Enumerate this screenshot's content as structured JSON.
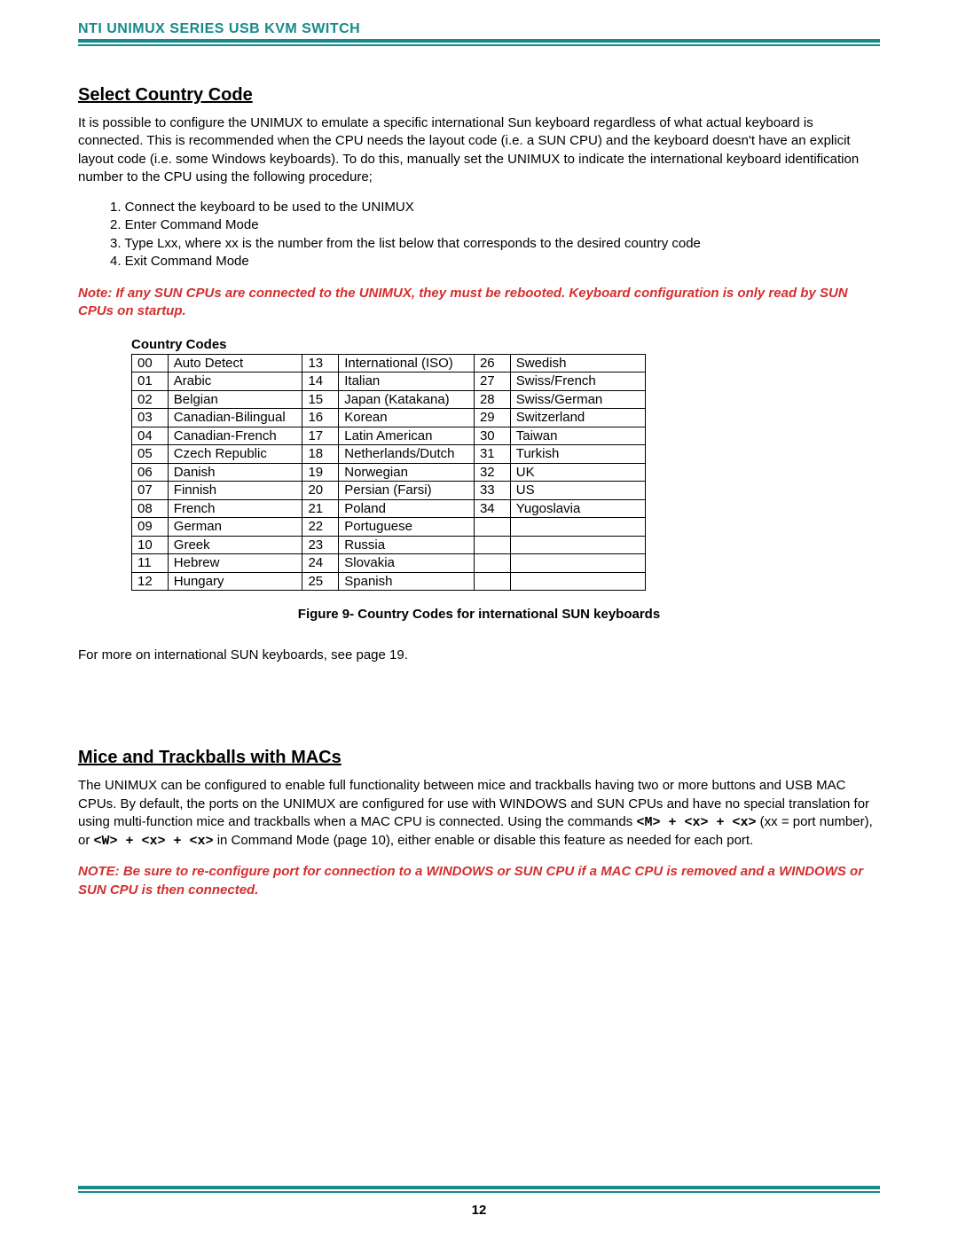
{
  "header": "NTI UNIMUX SERIES USB KVM SWITCH",
  "section1": {
    "title": "Select Country Code",
    "intro": "It is possible to configure the UNIMUX to emulate a specific international Sun keyboard regardless of what actual keyboard is connected.  This is recommended when the CPU needs the layout code (i.e. a SUN CPU) and the keyboard doesn't have an explicit layout code (i.e. some Windows keyboards).   To do this, manually set the UNIMUX to indicate the international keyboard identification number to the CPU using the following procedure;",
    "steps": [
      "1.  Connect the keyboard to be used to the UNIMUX",
      "2.  Enter Command Mode",
      "3.  Type Lxx, where xx is the number from the list below that corresponds to the desired country code",
      "4.  Exit Command Mode"
    ],
    "note": "Note:  If any SUN CPUs are connected to the UNIMUX, they must be rebooted.  Keyboard configuration is only read by SUN CPUs on startup.",
    "table_title": "Country Codes",
    "rows": [
      [
        "00",
        "Auto Detect",
        "13",
        "International (ISO)",
        "26",
        "Swedish"
      ],
      [
        "01",
        "Arabic",
        "14",
        "Italian",
        "27",
        "Swiss/French"
      ],
      [
        "02",
        "Belgian",
        "15",
        "Japan (Katakana)",
        "28",
        "Swiss/German"
      ],
      [
        "03",
        "Canadian-Bilingual",
        "16",
        "Korean",
        "29",
        "Switzerland"
      ],
      [
        "04",
        "Canadian-French",
        "17",
        "Latin American",
        "30",
        "Taiwan"
      ],
      [
        "05",
        "Czech Republic",
        "18",
        "Netherlands/Dutch",
        "31",
        "Turkish"
      ],
      [
        "06",
        "Danish",
        "19",
        "Norwegian",
        "32",
        "UK"
      ],
      [
        "07",
        "Finnish",
        "20",
        "Persian (Farsi)",
        "33",
        "US"
      ],
      [
        "08",
        "French",
        "21",
        "Poland",
        "34",
        "Yugoslavia"
      ],
      [
        "09",
        "German",
        "22",
        "Portuguese",
        "",
        ""
      ],
      [
        "10",
        "Greek",
        "23",
        "Russia",
        "",
        ""
      ],
      [
        "11",
        "Hebrew",
        "24",
        "Slovakia",
        "",
        ""
      ],
      [
        "12",
        "Hungary",
        "25",
        "Spanish",
        "",
        ""
      ]
    ],
    "figure_caption": "Figure 9- Country Codes for international SUN keyboards",
    "after": "For more on international SUN keyboards, see page 19."
  },
  "section2": {
    "title": "Mice and Trackballs with MACs",
    "body_pre": "The UNIMUX can be configured to enable full functionality between mice and trackballs having two or more buttons and USB MAC CPUs.   By default,  the ports on the UNIMUX are configured for use with WINDOWS and SUN CPUs and have no special translation for using multi-function mice and trackballs when a MAC CPU is connected.   Using the commands ",
    "cmd1": "<M> + <x> + <x>",
    "body_mid": " (xx = port number), or ",
    "cmd2": "<W> + <x> + <x>",
    "body_post": " in Command Mode  (page 10), either enable or disable this feature as needed for each port.",
    "note": "NOTE:  Be sure to re-configure port for connection to a WINDOWS or SUN CPU if a MAC CPU is removed and a WINDOWS or SUN CPU is then connected."
  },
  "page_number": "12"
}
